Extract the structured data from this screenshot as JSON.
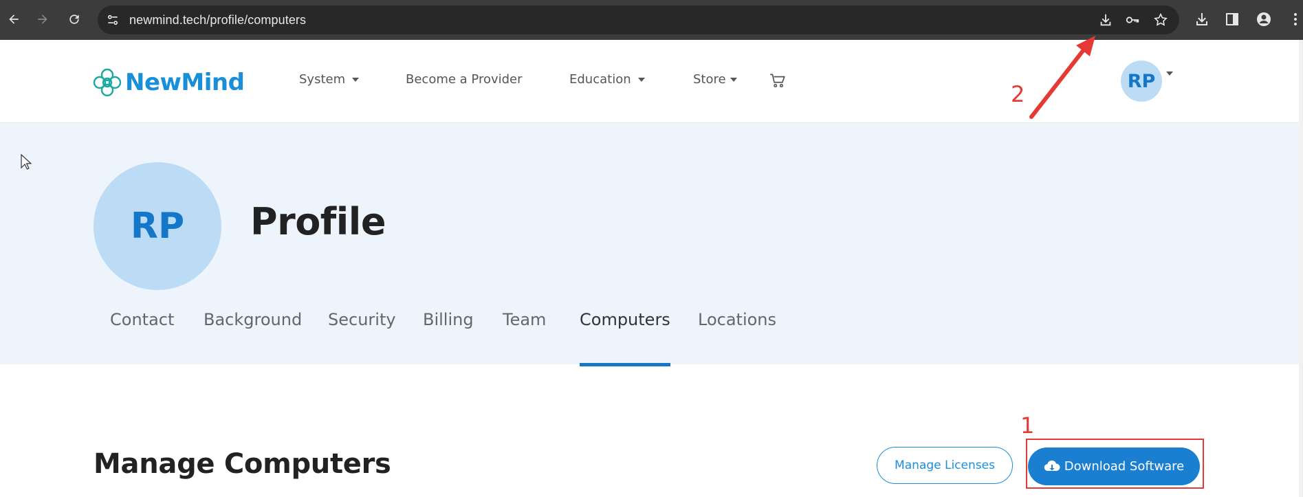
{
  "browser": {
    "url": "newmind.tech/profile/computers",
    "icons": [
      "back-icon",
      "forward-icon",
      "reload-icon",
      "site-settings-icon",
      "download-page-icon",
      "password-key-icon",
      "bookmark-star-icon",
      "downloads-icon",
      "side-panel-icon",
      "profile-icon",
      "menu-icon"
    ]
  },
  "site": {
    "logo_text": "NewMind",
    "nav": {
      "system": "System",
      "provider": "Become a Provider",
      "education": "Education",
      "store": "Store"
    },
    "avatar_initials": "RP"
  },
  "profile": {
    "initials": "RP",
    "title": "Profile",
    "tabs": [
      {
        "label": "Contact"
      },
      {
        "label": "Background"
      },
      {
        "label": "Security"
      },
      {
        "label": "Billing"
      },
      {
        "label": "Team"
      },
      {
        "label": "Computers",
        "active": true
      },
      {
        "label": "Locations"
      }
    ]
  },
  "section": {
    "title": "Manage Computers",
    "manage_licenses_label": "Manage Licenses",
    "download_software_label": "Download Software"
  },
  "annotations": {
    "step1": "1",
    "step2": "2",
    "color": "#e53935"
  },
  "colors": {
    "brand": "#1a8fd9",
    "primary_button": "#1a7fd0",
    "hero_background": "#edf4fb",
    "avatar_background": "#bcdcf5"
  }
}
